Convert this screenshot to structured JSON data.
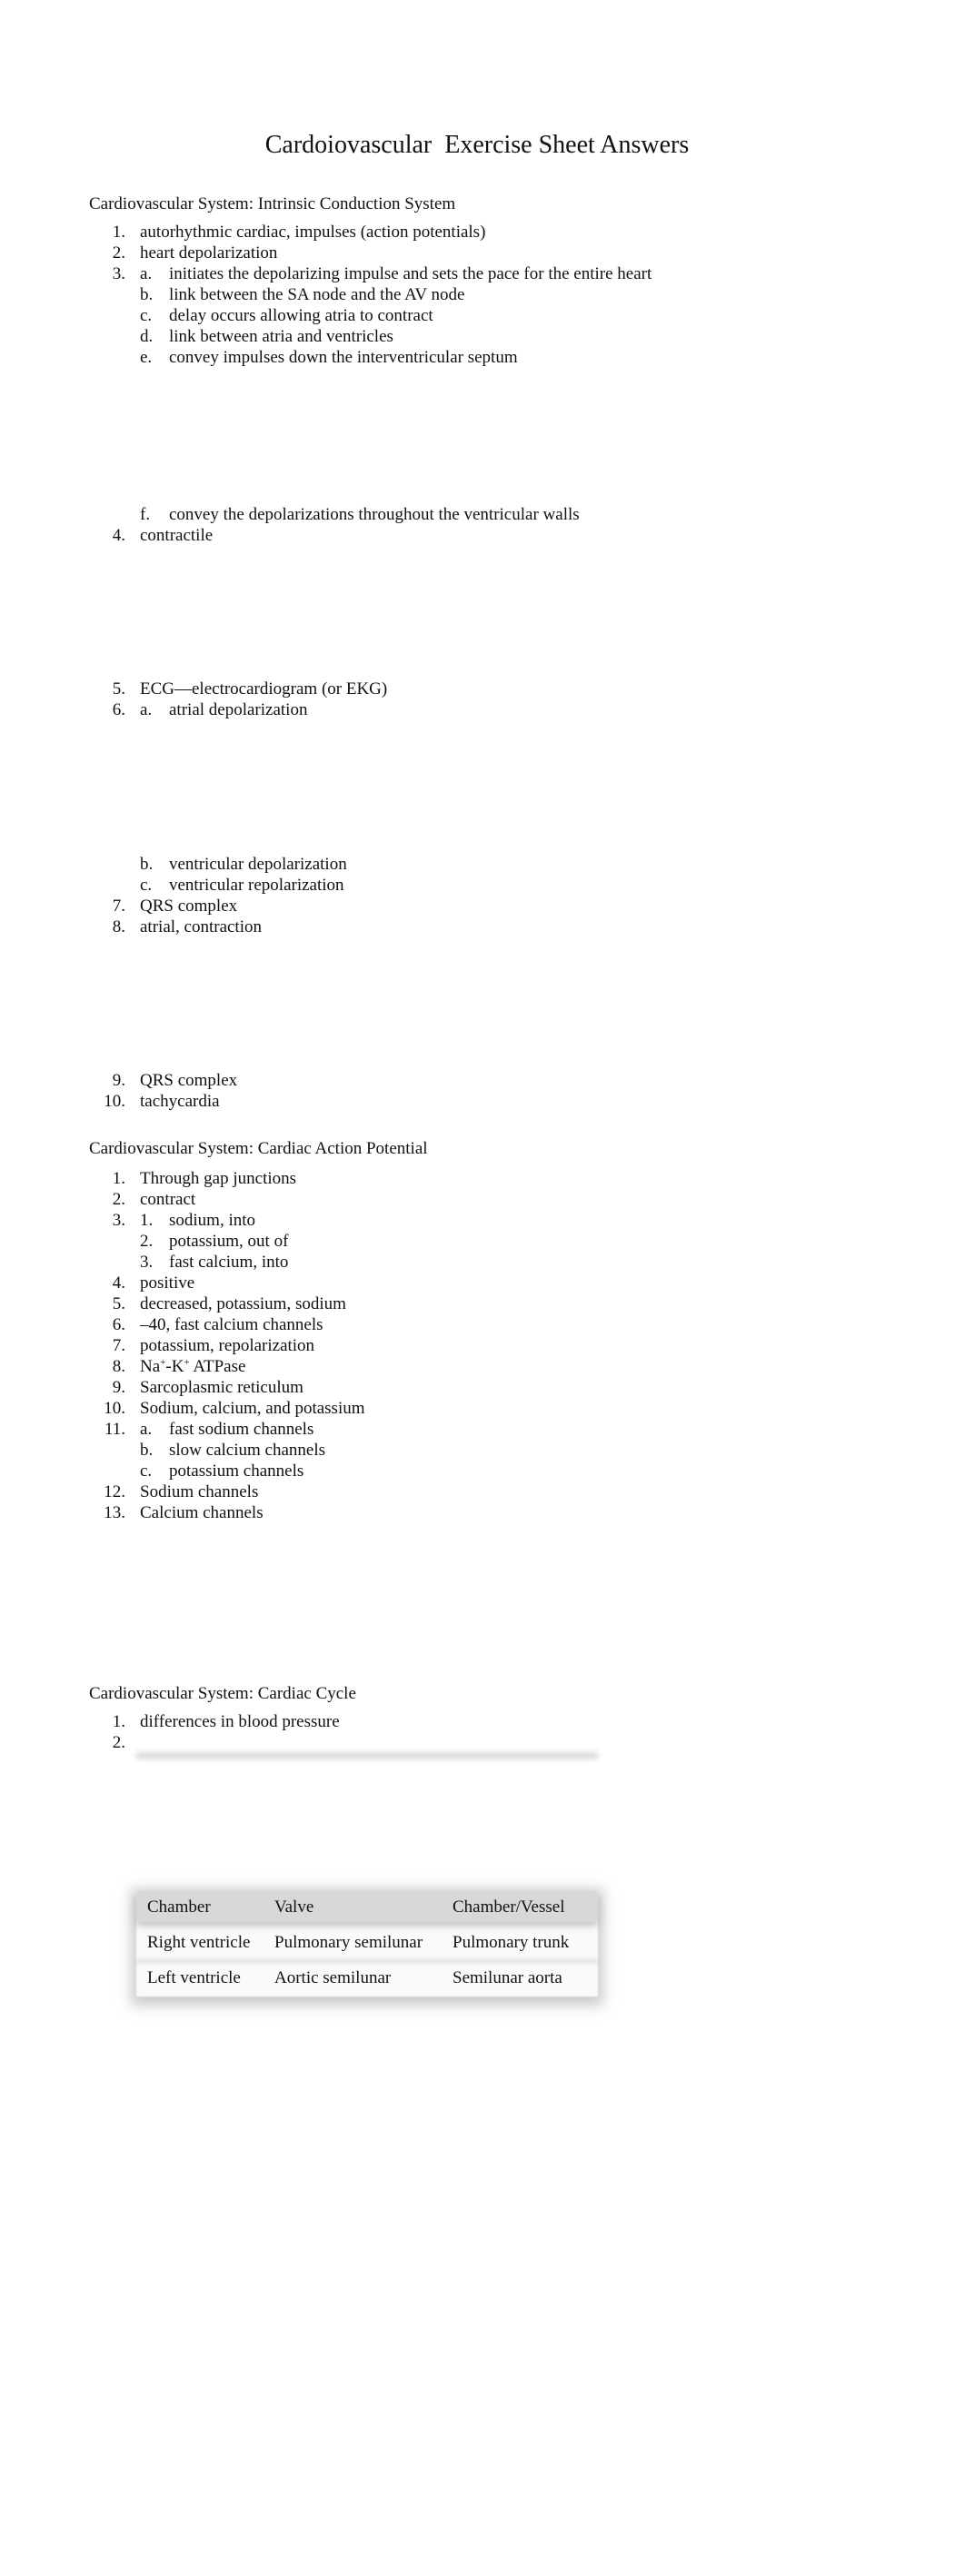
{
  "title": "Cardoiovascular  Exercise Sheet Answers",
  "sections": [
    {
      "heading": "Cardiovascular System: Intrinsic Conduction System",
      "items": [
        {
          "num": "1.",
          "text": "autorhythmic cardiac, impulses (action potentials)"
        },
        {
          "num": "2.",
          "text": "heart depolarization"
        },
        {
          "num": "3.",
          "sub": [
            {
              "label": "a.",
              "text": "initiates the depolarizing impulse and sets the pace for the entire heart"
            },
            {
              "label": "b.",
              "text": "link between the SA node and the AV node"
            },
            {
              "label": "c.",
              "text": "delay occurs allowing atria to contract"
            },
            {
              "label": "d.",
              "text": "link between atria and ventricles"
            },
            {
              "label": "e.",
              "text": "convey impulses down the interventricular septum"
            },
            {
              "label": "f.",
              "text": "convey the depolarizations throughout the ventricular walls"
            }
          ]
        },
        {
          "num": "4.",
          "text": "contractile"
        },
        {
          "num": "5.",
          "text": "ECG—electrocardiogram (or EKG)"
        },
        {
          "num": "6.",
          "sub": [
            {
              "label": "a.",
              "text": "atrial depolarization"
            },
            {
              "label": "b.",
              "text": "ventricular depolarization"
            },
            {
              "label": "c.",
              "text": "ventricular repolarization"
            }
          ]
        },
        {
          "num": "7.",
          "text": "QRS complex"
        },
        {
          "num": "8.",
          "text": "atrial, contraction"
        },
        {
          "num": "9.",
          "text": "QRS complex"
        },
        {
          "num": "10.",
          "text": "tachycardia"
        }
      ]
    },
    {
      "heading": "Cardiovascular System: Cardiac Action Potential",
      "items": [
        {
          "num": "1.",
          "text": "Through gap junctions"
        },
        {
          "num": "2.",
          "text": "contract"
        },
        {
          "num": "3.",
          "sub": [
            {
              "label": "1.",
              "text": "sodium, into"
            },
            {
              "label": "2.",
              "text": "potassium, out of"
            },
            {
              "label": "3.",
              "text": "fast calcium, into"
            }
          ]
        },
        {
          "num": "4.",
          "text": "positive"
        },
        {
          "num": "5.",
          "text": "decreased, potassium, sodium"
        },
        {
          "num": "6.",
          "text": "–40, fast calcium channels"
        },
        {
          "num": "7.",
          "text": "potassium, repolarization"
        },
        {
          "num": "8.",
          "text_parts": {
            "na": "Na",
            "plus1": "+",
            "dash_k": "-K",
            "plus2": "+",
            "rest": " ATPase"
          }
        },
        {
          "num": "9.",
          "text": "Sarcoplasmic reticulum"
        },
        {
          "num": "10.",
          "text": "Sodium, calcium, and potassium"
        },
        {
          "num": "11.",
          "sub": [
            {
              "label": "a.",
              "text": "fast sodium channels"
            },
            {
              "label": "b.",
              "text": "slow calcium channels"
            },
            {
              "label": "c.",
              "text": "potassium channels"
            }
          ]
        },
        {
          "num": "12.",
          "text": "Sodium channels"
        },
        {
          "num": "13.",
          "text": "Calcium channels"
        }
      ]
    },
    {
      "heading": "Cardiovascular System: Cardiac Cycle",
      "items": [
        {
          "num": "1.",
          "text": "differences in blood pressure"
        },
        {
          "num": "2.",
          "text": ""
        }
      ],
      "table": {
        "headers": [
          "Chamber",
          "Valve",
          "Chamber/Vessel"
        ],
        "rows": [
          [
            "Right ventricle",
            "Pulmonary semilunar",
            "Pulmonary trunk"
          ],
          [
            "Left ventricle",
            "Aortic semilunar",
            "Semilunar aorta"
          ]
        ]
      }
    }
  ]
}
